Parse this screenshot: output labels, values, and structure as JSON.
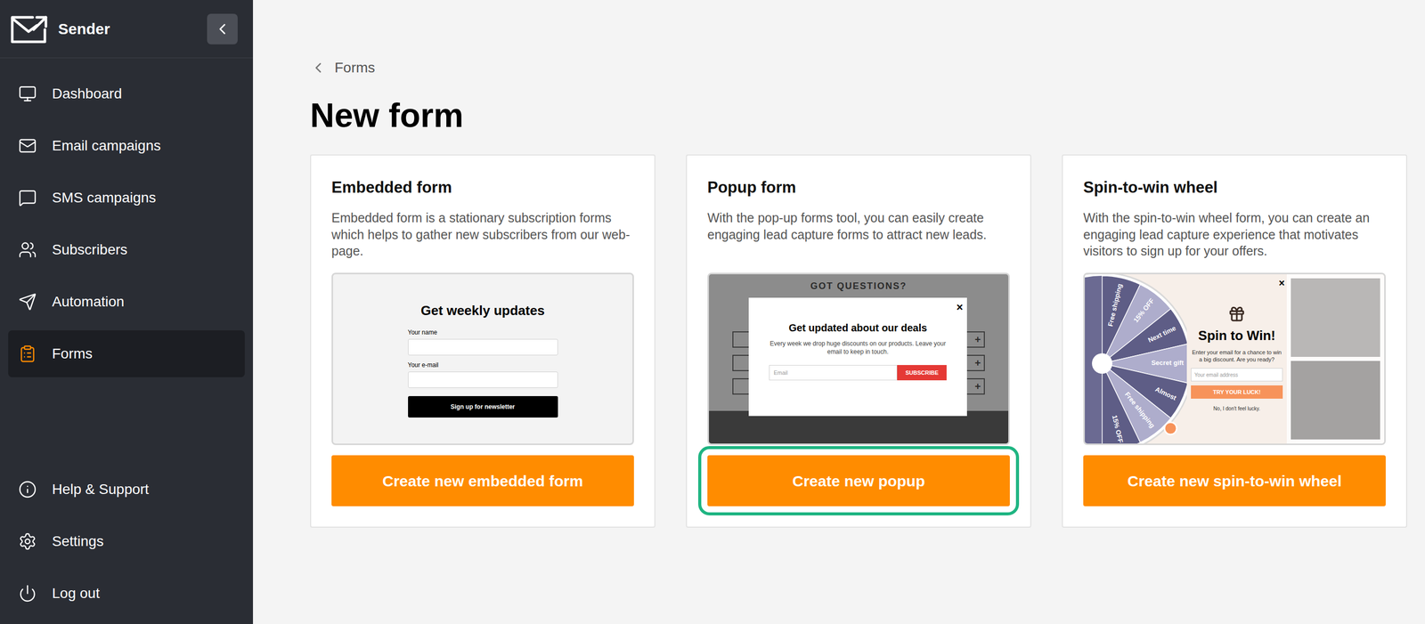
{
  "sidebar": {
    "brand": "Sender",
    "items": [
      {
        "label": "Dashboard",
        "selected": false
      },
      {
        "label": "Email campaigns",
        "selected": false
      },
      {
        "label": "SMS campaigns",
        "selected": false
      },
      {
        "label": "Subscribers",
        "selected": false
      },
      {
        "label": "Automation",
        "selected": false
      },
      {
        "label": "Forms",
        "selected": true
      }
    ],
    "bottom_items": [
      {
        "label": "Help & Support"
      },
      {
        "label": "Settings"
      },
      {
        "label": "Log out"
      }
    ]
  },
  "breadcrumb": "Forms",
  "title": "New form",
  "cards": [
    {
      "kind": "embedded",
      "title": "Embedded form",
      "description": "Embedded form is a stationary subscription forms which helps to gather new subscribers from our web-page.",
      "button": "Create new embedded form",
      "highlighted": false,
      "preview": {
        "heading": "Get weekly updates",
        "fields": [
          "Your name",
          "Your e-mail"
        ],
        "button": "Sign up for newsletter"
      }
    },
    {
      "kind": "popup",
      "title": "Popup form",
      "description": "With the pop-up forms tool, you can easily create engaging lead capture forms to attract new leads.",
      "button": "Create new popup",
      "highlighted": true,
      "preview": {
        "background_title": "GOT QUESTIONS?",
        "rows": [
          "+",
          "+",
          "+"
        ],
        "close": "×",
        "heading": "Get updated about our deals",
        "body": "Every week we drop huge discounts on our products. Leave your email to keep in touch.",
        "input_placeholder": "Email",
        "button": "SUBSCRIBE"
      }
    },
    {
      "kind": "spin",
      "title": "Spin-to-win wheel",
      "description": "With the spin-to-win wheel form, you can create an engaging lead capture experience that motivates visitors to sign up for your offers.",
      "button": "Create new spin-to-win wheel",
      "highlighted": false,
      "preview": {
        "segments": [
          "Free shipping",
          "15% OFF",
          "Next time",
          "Secret gift",
          "Almost",
          "Free shipping",
          "15% OFF"
        ],
        "close": "×",
        "heading": "Spin to Win!",
        "body": "Enter your email for a chance to win a big discount. Are you ready?",
        "input_placeholder": "Your email address",
        "button": "TRY YOUR LUCK!",
        "decline": "No, I don't feel lucky."
      }
    }
  ]
}
